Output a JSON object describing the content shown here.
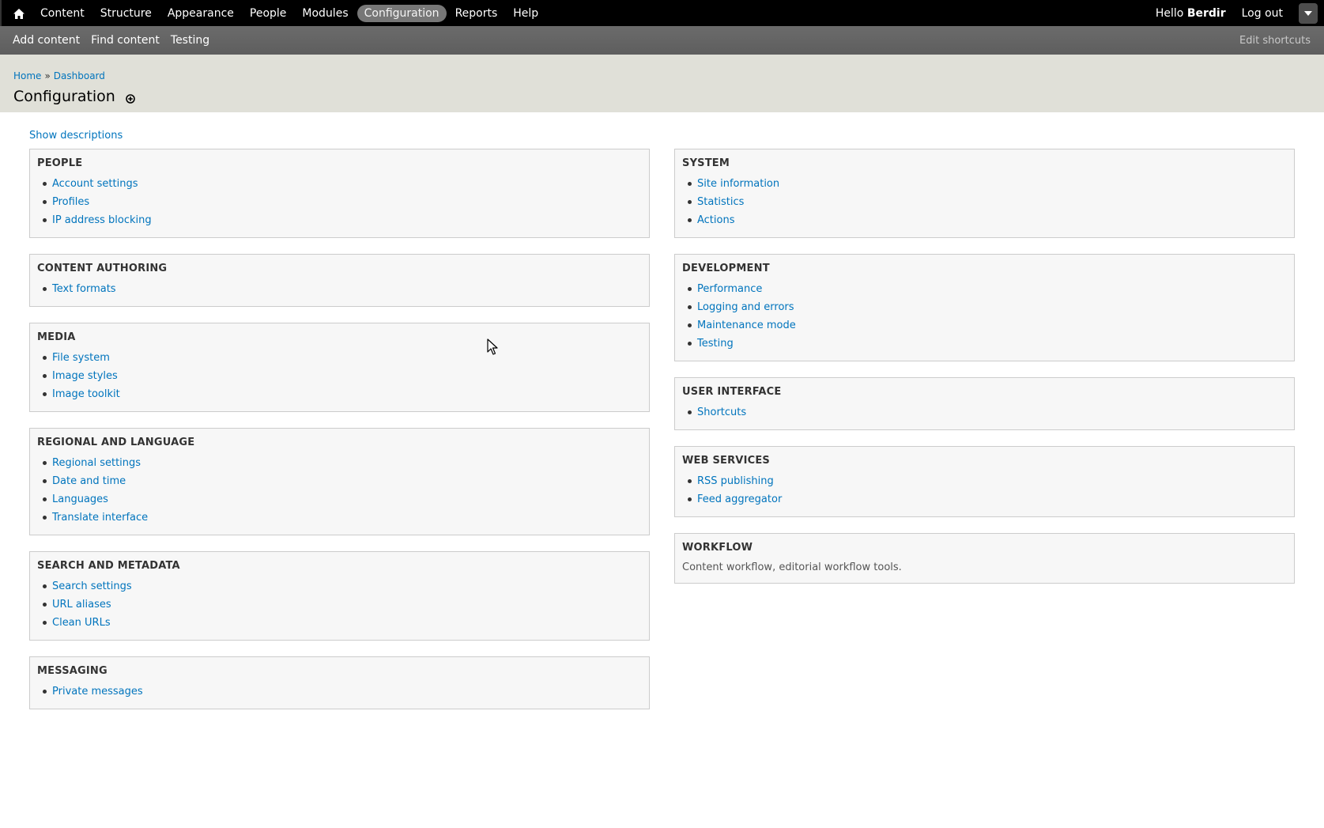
{
  "toolbar": {
    "home_icon": "home-icon",
    "menu": [
      {
        "label": "Content",
        "active": false
      },
      {
        "label": "Structure",
        "active": false
      },
      {
        "label": "Appearance",
        "active": false
      },
      {
        "label": "People",
        "active": false
      },
      {
        "label": "Modules",
        "active": false
      },
      {
        "label": "Configuration",
        "active": true
      },
      {
        "label": "Reports",
        "active": false
      },
      {
        "label": "Help",
        "active": false
      }
    ],
    "hello_prefix": "Hello ",
    "username": "Berdir",
    "logout": "Log out",
    "drawer_icon": "chevron-down-icon"
  },
  "shortcuts": {
    "items": [
      "Add content",
      "Find content",
      "Testing"
    ],
    "edit": "Edit shortcuts"
  },
  "breadcrumb": {
    "home": "Home",
    "separator": "»",
    "dashboard": "Dashboard"
  },
  "page": {
    "title": "Configuration",
    "add_shortcut_icon": "add-shortcut-icon",
    "show_descriptions": "Show descriptions"
  },
  "left_panels": [
    {
      "title": "PEOPLE",
      "links": [
        "Account settings",
        "Profiles",
        "IP address blocking"
      ]
    },
    {
      "title": "CONTENT AUTHORING",
      "links": [
        "Text formats"
      ]
    },
    {
      "title": "MEDIA",
      "links": [
        "File system",
        "Image styles",
        "Image toolkit"
      ]
    },
    {
      "title": "REGIONAL AND LANGUAGE",
      "links": [
        "Regional settings",
        "Date and time",
        "Languages",
        "Translate interface"
      ]
    },
    {
      "title": "SEARCH AND METADATA",
      "links": [
        "Search settings",
        "URL aliases",
        "Clean URLs"
      ]
    },
    {
      "title": "MESSAGING",
      "links": [
        "Private messages"
      ]
    }
  ],
  "right_panels": [
    {
      "title": "SYSTEM",
      "links": [
        "Site information",
        "Statistics",
        "Actions"
      ]
    },
    {
      "title": "DEVELOPMENT",
      "links": [
        "Performance",
        "Logging and errors",
        "Maintenance mode",
        "Testing"
      ]
    },
    {
      "title": "USER INTERFACE",
      "links": [
        "Shortcuts"
      ]
    },
    {
      "title": "WEB SERVICES",
      "links": [
        "RSS publishing",
        "Feed aggregator"
      ]
    },
    {
      "title": "WORKFLOW",
      "links": [],
      "description": "Content workflow, editorial workflow tools."
    }
  ],
  "colors": {
    "toolbar_bg": "#000000",
    "shortcuts_bg": "#666666",
    "branding_bg": "#e0e0d8",
    "link": "#0074bd",
    "panel_bg": "#f7f7f7",
    "panel_border": "#cccccc"
  }
}
